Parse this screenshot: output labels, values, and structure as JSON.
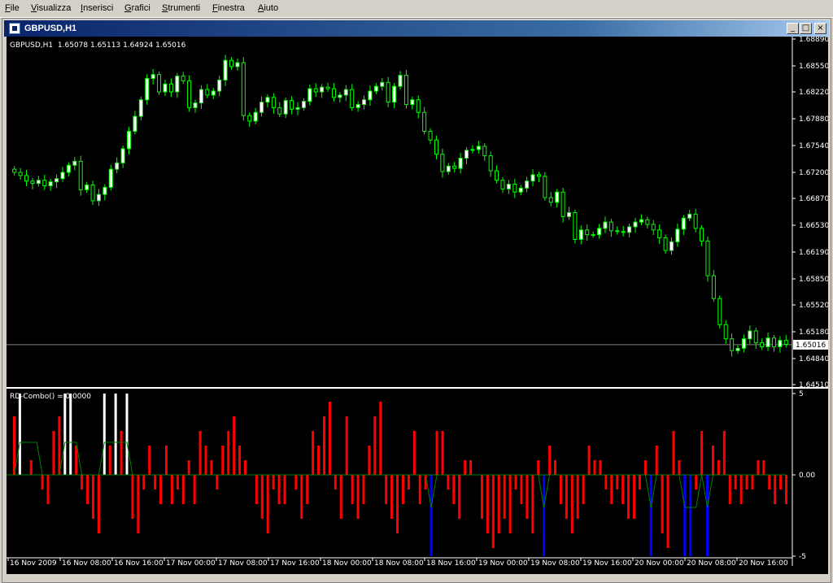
{
  "menu": [
    {
      "label": "File",
      "accel": "F",
      "rest": "ile"
    },
    {
      "label": "Visualizza",
      "accel": "V",
      "rest": "isualizza"
    },
    {
      "label": "Inserisci",
      "accel": "I",
      "rest": "nserisci"
    },
    {
      "label": "Grafici",
      "accel": "G",
      "rest": "rafici"
    },
    {
      "label": "Strumenti",
      "accel": "S",
      "rest": "trumenti"
    },
    {
      "label": "Finestra",
      "accel": "F",
      "rest": "inestra"
    },
    {
      "label": "Aiuto",
      "accel": "A",
      "rest": "iuto"
    }
  ],
  "window": {
    "title": "GBPUSD,H1",
    "min_glyph": "_",
    "max_glyph": "□",
    "close_glyph": "×"
  },
  "colors": {
    "background": "#000000",
    "bull_body": "#ffffff",
    "wick": "#00ff00",
    "axis": "#ffffff",
    "positive_hist": "#ff0000",
    "negative_hist": "#ff0000",
    "white_signal": "#ffffff",
    "blue_signal": "#0000ff",
    "signal_line": "#008000",
    "price_line": "#808080",
    "current_price_bg": "#ffffff"
  },
  "chart_data": [
    {
      "type": "candlestick",
      "title": "GBPUSD,H1",
      "ohlc_label": "1.65078 1.65113 1.64924 1.65016",
      "symbol_label": "GBPUSD,H1",
      "ylim": [
        1.6451,
        1.6889
      ],
      "y_ticks": [
        "1.68890",
        "1.68550",
        "1.68220",
        "1.67880",
        "1.67540",
        "1.67200",
        "1.66870",
        "1.66530",
        "1.66190",
        "1.65850",
        "1.65520",
        "1.65180",
        "1.64840",
        "1.64510"
      ],
      "current_price": "1.65016",
      "current_price_value": 1.65016,
      "x_tick_labels": [
        "16 Nov 2009",
        "16 Nov 08:00",
        "16 Nov 16:00",
        "17 Nov 00:00",
        "17 Nov 08:00",
        "17 Nov 16:00",
        "18 Nov 00:00",
        "18 Nov 08:00",
        "18 Nov 16:00",
        "19 Nov 00:00",
        "19 Nov 08:00",
        "19 Nov 16:00",
        "20 Nov 00:00",
        "20 Nov 08:00",
        "20 Nov 16:00"
      ],
      "close": [
        1.672,
        1.6716,
        1.6709,
        1.6706,
        1.671,
        1.6703,
        1.6708,
        1.6712,
        1.672,
        1.6729,
        1.6734,
        1.6698,
        1.6704,
        1.6684,
        1.6692,
        1.6701,
        1.6724,
        1.6732,
        1.675,
        1.6772,
        1.6791,
        1.6812,
        1.6839,
        1.6844,
        1.6822,
        1.6832,
        1.6822,
        1.6842,
        1.6836,
        1.6802,
        1.6808,
        1.6825,
        1.6818,
        1.6823,
        1.6837,
        1.6862,
        1.6854,
        1.6859,
        1.6792,
        1.6785,
        1.6796,
        1.6809,
        1.6815,
        1.6802,
        1.6794,
        1.6811,
        1.68,
        1.6802,
        1.681,
        1.6826,
        1.6822,
        1.6828,
        1.6826,
        1.6815,
        1.6818,
        1.6825,
        1.6802,
        1.6806,
        1.6812,
        1.6823,
        1.6829,
        1.6834,
        1.6809,
        1.6829,
        1.6843,
        1.6806,
        1.6812,
        1.6796,
        1.6772,
        1.6761,
        1.6743,
        1.6721,
        1.6728,
        1.6725,
        1.6738,
        1.6748,
        1.6749,
        1.6753,
        1.6741,
        1.6722,
        1.671,
        1.6699,
        1.6705,
        1.6695,
        1.67,
        1.6709,
        1.6717,
        1.6715,
        1.6688,
        1.6682,
        1.6695,
        1.6664,
        1.6669,
        1.6635,
        1.6647,
        1.6641,
        1.6641,
        1.6649,
        1.6657,
        1.6646,
        1.6645,
        1.6644,
        1.6651,
        1.6657,
        1.666,
        1.6654,
        1.6647,
        1.6637,
        1.6621,
        1.6632,
        1.6648,
        1.6662,
        1.6667,
        1.6649,
        1.6633,
        1.6589,
        1.656,
        1.6527,
        1.6509,
        1.6494,
        1.6497,
        1.6509,
        1.6519,
        1.6504,
        1.6499,
        1.651,
        1.6499,
        1.6507,
        1.6502
      ]
    },
    {
      "type": "histogram",
      "title": "RD-Combo()",
      "value_label": "RD-Combo() = 0.0000",
      "ylim": [
        -5,
        5
      ],
      "y_ticks": [
        "5",
        "0.00",
        "-5"
      ],
      "values": [
        4,
        3,
        0,
        1,
        0,
        -1,
        -2,
        3,
        4,
        -2,
        3,
        2,
        -1,
        -2,
        -3,
        -4,
        -1,
        2,
        2,
        3,
        -2,
        -3,
        -4,
        -1,
        2,
        -1,
        -2,
        2,
        -2,
        -1,
        -2,
        1,
        -2,
        3,
        2,
        1,
        -1,
        2,
        3,
        4,
        2,
        1,
        0,
        -2,
        -3,
        -4,
        -1,
        -2,
        -2,
        0,
        -1,
        -3,
        -2,
        3,
        2,
        4,
        5,
        -1,
        -3,
        4,
        -2,
        -3,
        -2,
        2,
        4,
        5,
        -2,
        -3,
        -4,
        -2,
        -1,
        3,
        -2,
        -1,
        2,
        3,
        3,
        -1,
        -2,
        -3,
        1,
        1,
        0,
        -3,
        -4,
        -5,
        -4,
        -3,
        -4,
        -1,
        -2,
        -3,
        -4,
        1,
        1,
        2,
        1,
        -2,
        -3,
        -4,
        -3,
        -2,
        2,
        1,
        1,
        -1,
        -2,
        -1,
        -2,
        -3,
        -3,
        -1,
        1,
        2,
        2,
        -4,
        -5,
        3,
        1,
        -1,
        -2,
        -1,
        3,
        2,
        2,
        1,
        3,
        -2,
        -1,
        -2,
        -1,
        -1,
        1,
        1,
        -1,
        -2,
        -1,
        -2
      ],
      "signals": [
        {
          "index": 1,
          "color": "#ffffff",
          "dir": "up"
        },
        {
          "index": 9,
          "color": "#ffffff",
          "dir": "up"
        },
        {
          "index": 10,
          "color": "#ffffff",
          "dir": "up"
        },
        {
          "index": 16,
          "color": "#ffffff",
          "dir": "up"
        },
        {
          "index": 18,
          "color": "#ffffff",
          "dir": "up"
        },
        {
          "index": 20,
          "color": "#ffffff",
          "dir": "up"
        },
        {
          "index": 74,
          "color": "#0000ff",
          "dir": "down"
        },
        {
          "index": 94,
          "color": "#0000ff",
          "dir": "down"
        },
        {
          "index": 113,
          "color": "#0000ff",
          "dir": "down"
        },
        {
          "index": 119,
          "color": "#0000ff",
          "dir": "down"
        },
        {
          "index": 120,
          "color": "#0000ff",
          "dir": "down"
        },
        {
          "index": 123,
          "color": "#0000ff",
          "dir": "down"
        }
      ]
    }
  ]
}
